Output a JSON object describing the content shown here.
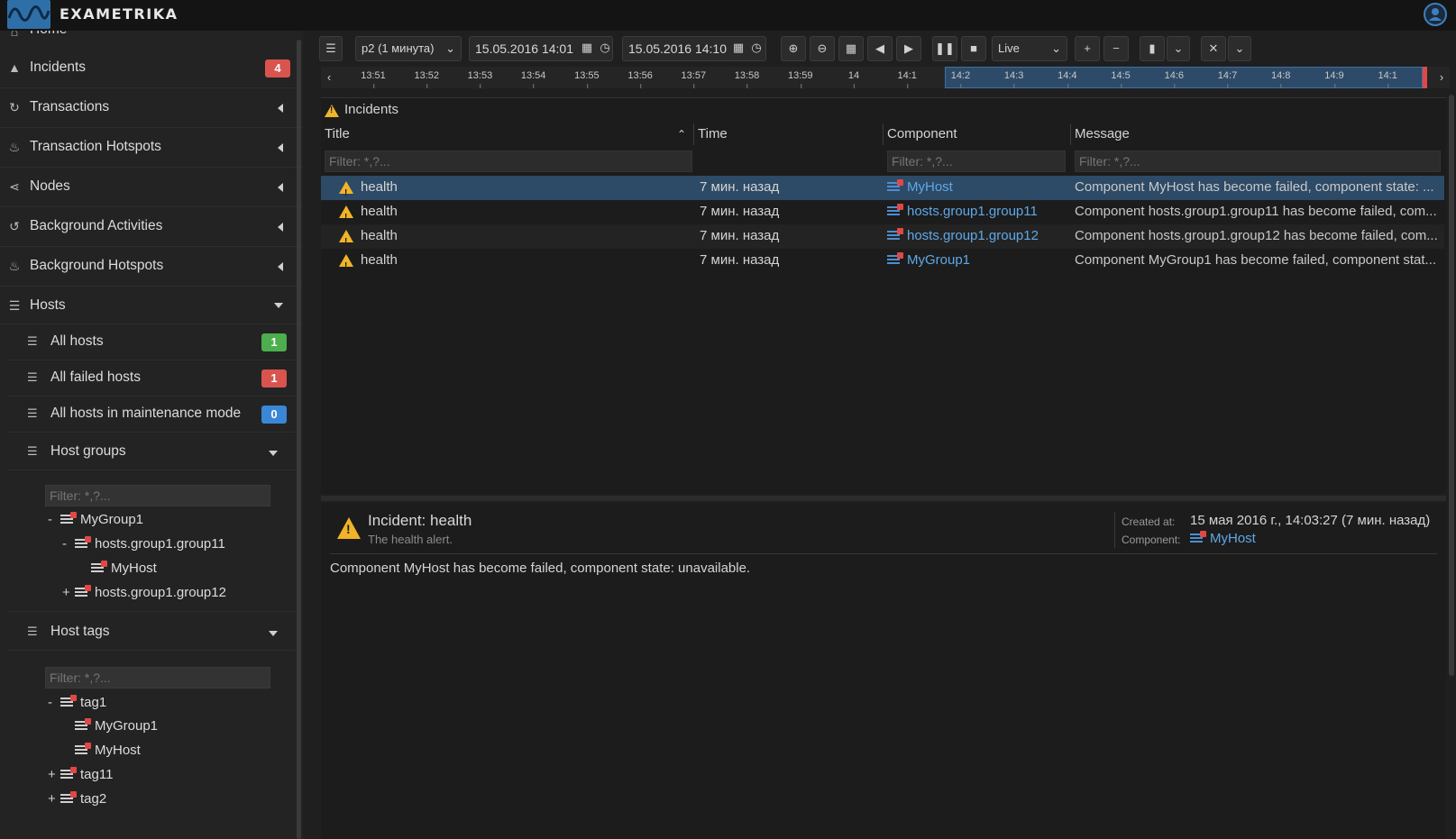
{
  "app": {
    "name": "EXAMETRIKA"
  },
  "sidebar": {
    "home": "Home",
    "items": [
      {
        "label": "Incidents",
        "badge": "4"
      },
      {
        "label": "Transactions"
      },
      {
        "label": "Transaction Hotspots"
      },
      {
        "label": "Nodes"
      },
      {
        "label": "Background Activities"
      },
      {
        "label": "Background Hotspots"
      },
      {
        "label": "Hosts"
      }
    ],
    "hosts_sub": [
      {
        "label": "All hosts",
        "badge": "1"
      },
      {
        "label": "All failed hosts",
        "badge": "1"
      },
      {
        "label": "All hosts in maintenance mode",
        "badge": "0"
      }
    ],
    "host_groups": {
      "label": "Host groups",
      "filter_placeholder": "Filter: *,?...",
      "tree": [
        {
          "toggle": "-",
          "label": "MyGroup1"
        },
        {
          "toggle": "-",
          "label": "hosts.group1.group11"
        },
        {
          "toggle": "",
          "label": "MyHost"
        },
        {
          "toggle": "+",
          "label": "hosts.group1.group12"
        }
      ]
    },
    "host_tags": {
      "label": "Host tags",
      "filter_placeholder": "Filter: *,?...",
      "tree": [
        {
          "toggle": "-",
          "label": "tag1"
        },
        {
          "toggle": "",
          "label": "MyGroup1"
        },
        {
          "toggle": "",
          "label": "MyHost"
        },
        {
          "toggle": "+",
          "label": "tag11"
        },
        {
          "toggle": "+",
          "label": "tag2"
        }
      ]
    }
  },
  "toolbar": {
    "period": "p2 (1 минута)",
    "from": "15.05.2016 14:01",
    "to": "15.05.2016 14:10",
    "mode": "Live"
  },
  "timeline": {
    "ticks": [
      "13:51",
      "13:52",
      "13:53",
      "13:54",
      "13:55",
      "13:56",
      "13:57",
      "13:58",
      "13:59",
      "14",
      "14:1",
      "14:2",
      "14:3",
      "14:4",
      "14:5",
      "14:6",
      "14:7",
      "14:8",
      "14:9",
      "14:1"
    ]
  },
  "incidents": {
    "panel_title": "Incidents",
    "columns": [
      "Title",
      "Time",
      "Component",
      "Message"
    ],
    "filter_placeholder": "Filter: *,?...",
    "rows": [
      {
        "title": "health",
        "time": "7 мин. назад",
        "component": "MyHost",
        "message": "Component MyHost has become failed, component state: ..."
      },
      {
        "title": "health",
        "time": "7 мин. назад",
        "component": "hosts.group1.group11",
        "message": "Component hosts.group1.group11 has become failed, com..."
      },
      {
        "title": "health",
        "time": "7 мин. назад",
        "component": "hosts.group1.group12",
        "message": "Component hosts.group1.group12 has become failed, com..."
      },
      {
        "title": "health",
        "time": "7 мин. назад",
        "component": "MyGroup1",
        "message": "Component MyGroup1 has become failed, component stat..."
      }
    ]
  },
  "details": {
    "title": "Incident: health",
    "subtitle": "The health alert.",
    "created_label": "Created at:",
    "created_value": "15 мая 2016 г., 14:03:27 (7 мин. назад)",
    "component_label": "Component:",
    "component_value": "MyHost",
    "message": "Component MyHost has become failed, component state: unavailable."
  },
  "colors": {
    "accent": "#5fa8e8",
    "selection": "#2d4a66",
    "danger": "#e04848",
    "warning": "#f0b429"
  }
}
